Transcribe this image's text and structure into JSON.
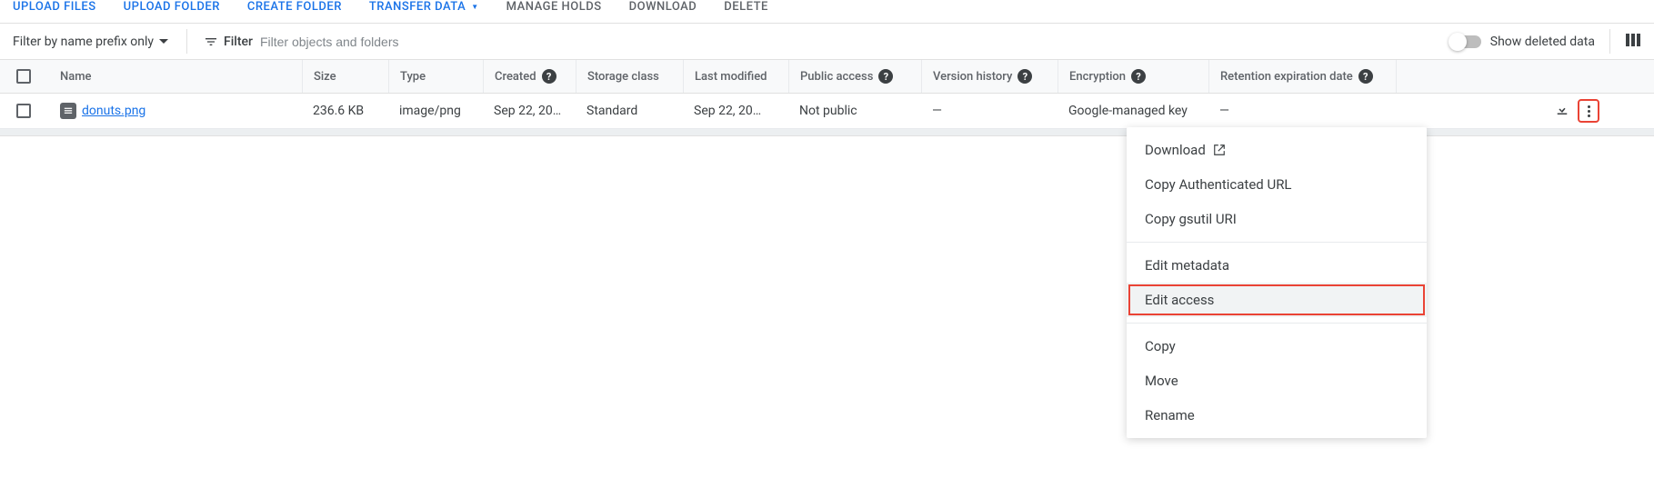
{
  "toolbar": {
    "upload_files": "UPLOAD FILES",
    "upload_folder": "UPLOAD FOLDER",
    "create_folder": "CREATE FOLDER",
    "transfer_data": "TRANSFER DATA",
    "manage_holds": "MANAGE HOLDS",
    "download": "DOWNLOAD",
    "delete": "DELETE"
  },
  "filter": {
    "mode": "Filter by name prefix only",
    "label": "Filter",
    "placeholder": "Filter objects and folders",
    "show_deleted": "Show deleted data"
  },
  "table": {
    "headers": {
      "name": "Name",
      "size": "Size",
      "type": "Type",
      "created": "Created",
      "storage_class": "Storage class",
      "last_modified": "Last modified",
      "public_access": "Public access",
      "version_history": "Version history",
      "encryption": "Encryption",
      "retention_expiration": "Retention expiration date"
    },
    "rows": [
      {
        "name": "donuts.png",
        "size": "236.6 KB",
        "type": "image/png",
        "created": "Sep 22, 20…",
        "storage_class": "Standard",
        "last_modified": "Sep 22, 20…",
        "public_access": "Not public",
        "version_history": "—",
        "encryption": "Google-managed key",
        "retention_expiration": "—"
      }
    ]
  },
  "menu": {
    "download": "Download",
    "copy_auth_url": "Copy Authenticated URL",
    "copy_gsutil": "Copy gsutil URI",
    "edit_metadata": "Edit metadata",
    "edit_access": "Edit access",
    "copy": "Copy",
    "move": "Move",
    "rename": "Rename"
  }
}
